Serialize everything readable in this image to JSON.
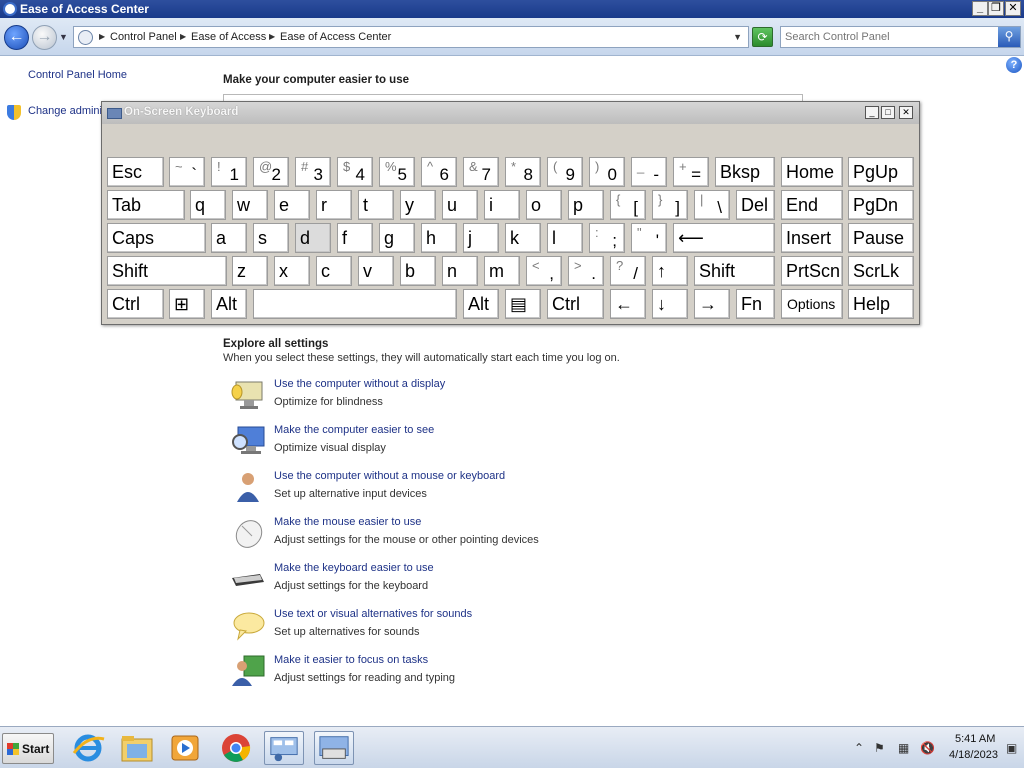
{
  "window": {
    "title": "Ease of Access Center"
  },
  "caption_buttons": {
    "minimize": "_",
    "maximize": "❐",
    "close": "✕"
  },
  "address": {
    "crumbs": [
      "Control Panel",
      "Ease of Access",
      "Ease of Access Center"
    ],
    "search_placeholder": "Search Control Panel"
  },
  "left_nav": {
    "home": "Control Panel Home",
    "change_admin": "Change adminis"
  },
  "main": {
    "heading": "Make your computer easier to use",
    "explore_title": "Explore all settings",
    "explore_desc": "When you select these settings, they will automatically start each time you log on.",
    "settings": [
      {
        "link": "Use the computer without a display",
        "desc": "Optimize for blindness",
        "icon": "monitor-speaker-icon"
      },
      {
        "link": "Make the computer easier to see",
        "desc": "Optimize visual display",
        "icon": "magnifier-monitor-icon"
      },
      {
        "link": "Use the computer without a mouse or keyboard",
        "desc": "Set up alternative input devices",
        "icon": "person-icon"
      },
      {
        "link": "Make the mouse easier to use",
        "desc": "Adjust settings for the mouse or other pointing devices",
        "icon": "mouse-icon"
      },
      {
        "link": "Make the keyboard easier to use",
        "desc": "Adjust settings for the keyboard",
        "icon": "keyboard-icon"
      },
      {
        "link": "Use text or visual alternatives for sounds",
        "desc": "Set up alternatives for sounds",
        "icon": "speech-bubble-icon"
      },
      {
        "link": "Make it easier to focus on tasks",
        "desc": "Adjust settings for reading and typing",
        "icon": "users-icon"
      }
    ]
  },
  "osk": {
    "title": "On-Screen Keyboard",
    "keys": [
      {
        "id": "esc",
        "label": "Esc"
      },
      {
        "id": "tilde",
        "shift": "~",
        "base": "`"
      },
      {
        "id": "1",
        "shift": "!",
        "base": "1"
      },
      {
        "id": "2",
        "shift": "@",
        "base": "2"
      },
      {
        "id": "3",
        "shift": "#",
        "base": "3"
      },
      {
        "id": "4",
        "shift": "$",
        "base": "4"
      },
      {
        "id": "5",
        "shift": "%",
        "base": "5"
      },
      {
        "id": "6",
        "shift": "^",
        "base": "6"
      },
      {
        "id": "7",
        "shift": "&",
        "base": "7"
      },
      {
        "id": "8",
        "shift": "*",
        "base": "8"
      },
      {
        "id": "9",
        "shift": "(",
        "base": "9"
      },
      {
        "id": "0",
        "shift": ")",
        "base": "0"
      },
      {
        "id": "minus",
        "shift": "_",
        "base": "-"
      },
      {
        "id": "equals",
        "shift": "+",
        "base": "="
      },
      {
        "id": "bksp",
        "label": "Bksp"
      },
      {
        "id": "home",
        "label": "Home"
      },
      {
        "id": "pgup",
        "label": "PgUp"
      },
      {
        "id": "tab",
        "label": "Tab"
      },
      {
        "id": "q",
        "label": "q"
      },
      {
        "id": "w",
        "label": "w"
      },
      {
        "id": "e",
        "label": "e"
      },
      {
        "id": "r",
        "label": "r"
      },
      {
        "id": "t",
        "label": "t"
      },
      {
        "id": "y",
        "label": "y"
      },
      {
        "id": "u",
        "label": "u"
      },
      {
        "id": "i",
        "label": "i"
      },
      {
        "id": "o",
        "label": "o"
      },
      {
        "id": "p",
        "label": "p"
      },
      {
        "id": "lbracket",
        "shift": "{",
        "base": "["
      },
      {
        "id": "rbracket",
        "shift": "}",
        "base": "]"
      },
      {
        "id": "backslash",
        "shift": "|",
        "base": "\\"
      },
      {
        "id": "del",
        "label": "Del"
      },
      {
        "id": "end",
        "label": "End"
      },
      {
        "id": "pgdn",
        "label": "PgDn"
      },
      {
        "id": "caps",
        "label": "Caps"
      },
      {
        "id": "a",
        "label": "a"
      },
      {
        "id": "s",
        "label": "s"
      },
      {
        "id": "d",
        "label": "d"
      },
      {
        "id": "f",
        "label": "f"
      },
      {
        "id": "g",
        "label": "g"
      },
      {
        "id": "h",
        "label": "h"
      },
      {
        "id": "j",
        "label": "j"
      },
      {
        "id": "k",
        "label": "k"
      },
      {
        "id": "l",
        "label": "l"
      },
      {
        "id": "semicolon",
        "shift": ":",
        "base": ";"
      },
      {
        "id": "quote",
        "shift": "\"",
        "base": "'"
      },
      {
        "id": "enter",
        "label": "⟵"
      },
      {
        "id": "insert",
        "label": "Insert"
      },
      {
        "id": "pause",
        "label": "Pause"
      },
      {
        "id": "lshift",
        "label": "Shift"
      },
      {
        "id": "z",
        "label": "z"
      },
      {
        "id": "x",
        "label": "x"
      },
      {
        "id": "c",
        "label": "c"
      },
      {
        "id": "v",
        "label": "v"
      },
      {
        "id": "b",
        "label": "b"
      },
      {
        "id": "n",
        "label": "n"
      },
      {
        "id": "m",
        "label": "m"
      },
      {
        "id": "comma",
        "shift": "<",
        "base": ","
      },
      {
        "id": "period",
        "shift": ">",
        "base": "."
      },
      {
        "id": "slash",
        "shift": "?",
        "base": "/"
      },
      {
        "id": "up",
        "label": "↑"
      },
      {
        "id": "rshift",
        "label": "Shift"
      },
      {
        "id": "prtscn",
        "label": "PrtScn"
      },
      {
        "id": "scrlk",
        "label": "ScrLk"
      },
      {
        "id": "lctrl",
        "label": "Ctrl"
      },
      {
        "id": "win",
        "label": "⊞"
      },
      {
        "id": "lalt",
        "label": "Alt"
      },
      {
        "id": "space",
        "label": ""
      },
      {
        "id": "ralt",
        "label": "Alt"
      },
      {
        "id": "menu",
        "label": "▤"
      },
      {
        "id": "rctrl",
        "label": "Ctrl"
      },
      {
        "id": "left",
        "label": "←"
      },
      {
        "id": "down",
        "label": "↓"
      },
      {
        "id": "right",
        "label": "→"
      },
      {
        "id": "fn",
        "label": "Fn"
      },
      {
        "id": "options",
        "label": "Options"
      },
      {
        "id": "help",
        "label": "Help"
      }
    ]
  },
  "taskbar": {
    "start_label": "Start",
    "clock_time": "5:41 AM",
    "clock_date": "4/18/2023",
    "apps": [
      "internet-explorer-icon",
      "file-explorer-icon",
      "media-player-icon",
      "chrome-icon",
      "control-panel-icon",
      "on-screen-keyboard-icon"
    ]
  },
  "colors": {
    "link": "#1e3287",
    "titlebar": "#193a8a",
    "osk_face": "#d4d0c8"
  }
}
